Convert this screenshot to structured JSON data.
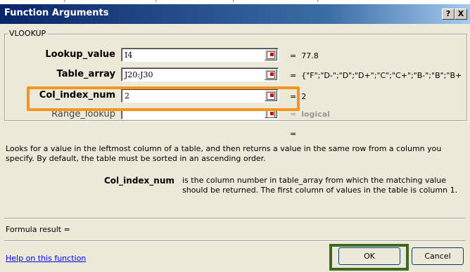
{
  "window": {
    "title": "Function Arguments",
    "help_btn": "?",
    "close_btn": "X"
  },
  "group": {
    "label": "VLOOKUP"
  },
  "args": [
    {
      "label": "Lookup_value",
      "value": "I4",
      "result": "77.8"
    },
    {
      "label": "Table_array",
      "value": "J20:J30",
      "result": "{\"F\";\"D-\";\"D\";\"D+\";\"C\";\"C+\";\"B-\";\"B\";\"B+"
    },
    {
      "label": "Col_index_num",
      "value": "2",
      "result": "2"
    },
    {
      "label": "Range_lookup",
      "value": "",
      "result": "logical"
    }
  ],
  "equals": "=",
  "description": "Looks for a value in the leftmost column of a table, and then returns a value in the same row from a column you specify. By default, the table must be sorted in an ascending order.",
  "arg_help": {
    "name": "Col_index_num",
    "text": "is the column number in table_array from which the matching value should be returned. The first column of values in the table is column 1."
  },
  "formula_result": "Formula result =",
  "help_link": "Help on this function",
  "buttons": {
    "ok": "OK",
    "cancel": "Cancel"
  },
  "colors": {
    "title_bar": "#0a246a",
    "dialog_bg": "#ece9d8",
    "highlight_orange": "#f4961e",
    "highlight_green": "#3d6b1e",
    "link": "#0000ee"
  }
}
